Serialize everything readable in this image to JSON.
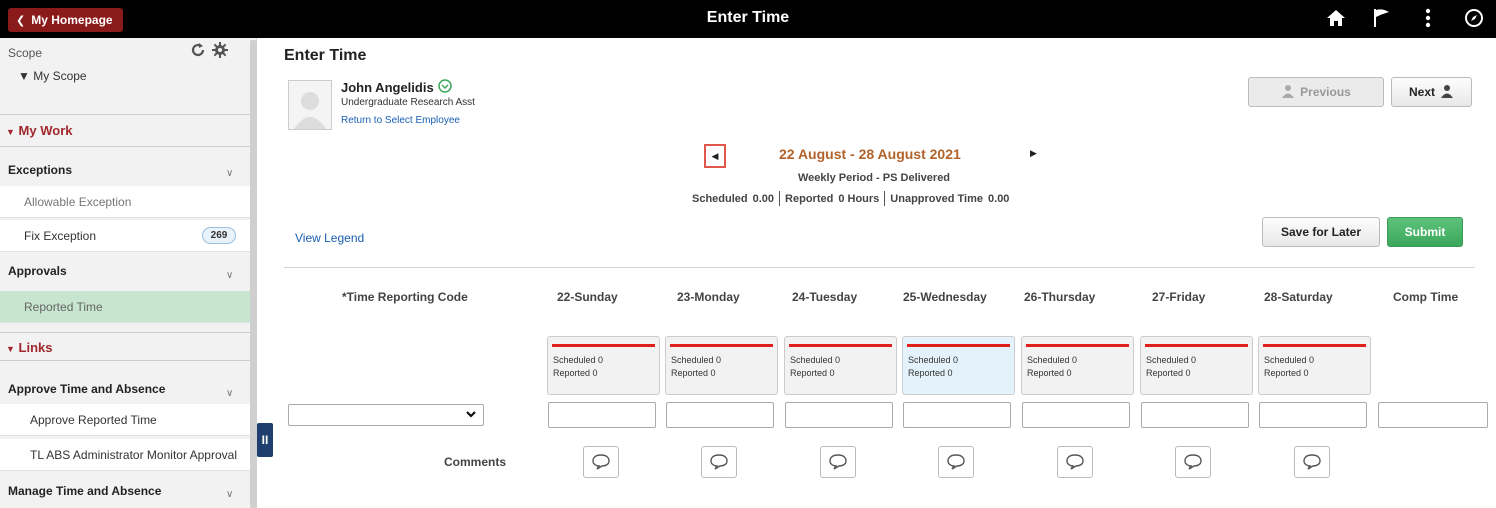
{
  "topbar": {
    "home_label": "My Homepage",
    "title": "Enter Time",
    "icons": [
      "home-icon",
      "flag-icon",
      "more-icon",
      "compass-icon"
    ]
  },
  "sidebar": {
    "scope_label": "Scope",
    "my_scope": "My Scope",
    "my_work": "My Work",
    "groups": {
      "exceptions": "Exceptions",
      "approvals": "Approvals",
      "approve_time": "Approve Time and Absence",
      "manage_time": "Manage Time and Absence"
    },
    "items": {
      "allowable_exception": "Allowable Exception",
      "fix_exception": "Fix Exception",
      "fix_exception_count": "269",
      "reported_time": "Reported Time",
      "approve_reported_time": "Approve Reported Time",
      "tl_abs": "TL ABS Administrator Monitor Approval"
    },
    "links": "Links",
    "collapse_glyph": "II"
  },
  "main": {
    "title": "Enter Time",
    "employee": {
      "name": "John Angelidis",
      "job_title": "Undergraduate Research Asst",
      "return_link": "Return to Select Employee"
    },
    "buttons": {
      "previous": "Previous",
      "next": "Next",
      "save_for_later": "Save for Later",
      "submit": "Submit"
    },
    "period": {
      "range": "22 August - 28 August 2021",
      "type": "Weekly Period - PS Delivered",
      "scheduled_label": "Scheduled",
      "scheduled_value": "0.00",
      "reported_label": "Reported",
      "reported_value": "0 Hours",
      "unapproved_label": "Unapproved Time",
      "unapproved_value": "0.00"
    },
    "view_legend": "View Legend",
    "grid": {
      "trc_header": "*Time Reporting Code",
      "comp_time_header": "Comp Time",
      "comments_label": "Comments",
      "days": [
        {
          "label": "22-Sunday",
          "scheduled": "Scheduled 0",
          "reported": "Reported  0"
        },
        {
          "label": "23-Monday",
          "scheduled": "Scheduled 0",
          "reported": "Reported  0"
        },
        {
          "label": "24-Tuesday",
          "scheduled": "Scheduled 0",
          "reported": "Reported  0"
        },
        {
          "label": "25-Wednesday",
          "scheduled": "Scheduled 0",
          "reported": "Reported  0"
        },
        {
          "label": "26-Thursday",
          "scheduled": "Scheduled 0",
          "reported": "Reported  0"
        },
        {
          "label": "27-Friday",
          "scheduled": "Scheduled 0",
          "reported": "Reported  0"
        },
        {
          "label": "28-Saturday",
          "scheduled": "Scheduled 0",
          "reported": "Reported  0"
        }
      ]
    },
    "colors": {
      "accent_red": "#a0282d",
      "period_orange": "#b1632a",
      "link_blue": "#1a5fb4",
      "submit_green": "#3ca85c",
      "schedule_bar_red": "#e0201c"
    }
  }
}
